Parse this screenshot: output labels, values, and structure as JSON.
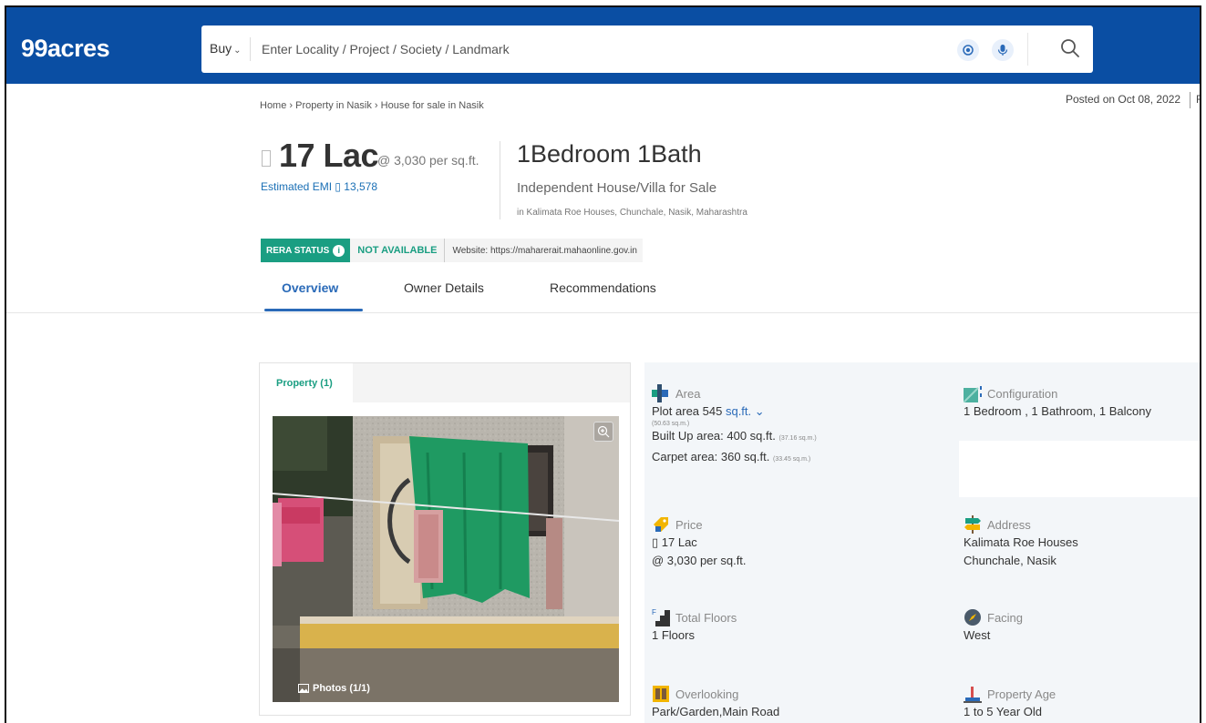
{
  "header": {
    "logo": "99acres",
    "search": {
      "type_label": "Buy",
      "placeholder": "Enter Locality / Project / Society / Landmark"
    }
  },
  "breadcrumb": "Home › Property in Nasik › House for sale in Nasik",
  "posted": "Posted on Oct 08, 2022",
  "posted_extra": "R",
  "price": {
    "amount": "17 Lac",
    "rate": "@ 3,030 per sq.ft.",
    "emi": "Estimated EMI ▯ 13,578"
  },
  "listing": {
    "title": "1Bedroom 1Bath",
    "subtitle": "Independent House/Villa for Sale",
    "location": "in Kalimata Roe Houses, Chunchale, Nasik, Maharashtra"
  },
  "rera": {
    "badge": "RERA STATUS",
    "status": "NOT AVAILABLE",
    "website": "Website: https://maharerait.mahaonline.gov.in"
  },
  "tabs": [
    {
      "label": "Overview",
      "active": true
    },
    {
      "label": "Owner Details",
      "active": false
    },
    {
      "label": "Recommendations",
      "active": false
    }
  ],
  "media": {
    "tab": "Property (1)",
    "photos_label": "Photos (1/1)"
  },
  "details": {
    "area": {
      "label": "Area",
      "plot": "Plot area 545",
      "unit": "sq.ft.",
      "plot_sqm": "(50.63 sq.m.)",
      "builtup": "Built Up area: 400 sq.ft.",
      "builtup_sqm": "(37.16 sq.m.)",
      "carpet": "Carpet area: 360 sq.ft.",
      "carpet_sqm": "(33.45 sq.m.)"
    },
    "configuration": {
      "label": "Configuration",
      "value": "1 Bedroom , 1 Bathroom, 1 Balcony"
    },
    "price": {
      "label": "Price",
      "value1": "▯ 17 Lac",
      "value2": "@ 3,030 per sq.ft."
    },
    "address": {
      "label": "Address",
      "value1": "Kalimata Roe Houses",
      "value2": "Chunchale, Nasik"
    },
    "floors": {
      "label": "Total Floors",
      "value": "1 Floors"
    },
    "facing": {
      "label": "Facing",
      "value": "West"
    },
    "overlooking": {
      "label": "Overlooking",
      "value": "Park/Garden,Main Road"
    },
    "age": {
      "label": "Property Age",
      "value": "1 to 5 Year Old"
    }
  },
  "colors": {
    "header_bg": "#0a4ea3",
    "accent_blue": "#2a6ab8",
    "accent_green": "#1a9e82"
  }
}
